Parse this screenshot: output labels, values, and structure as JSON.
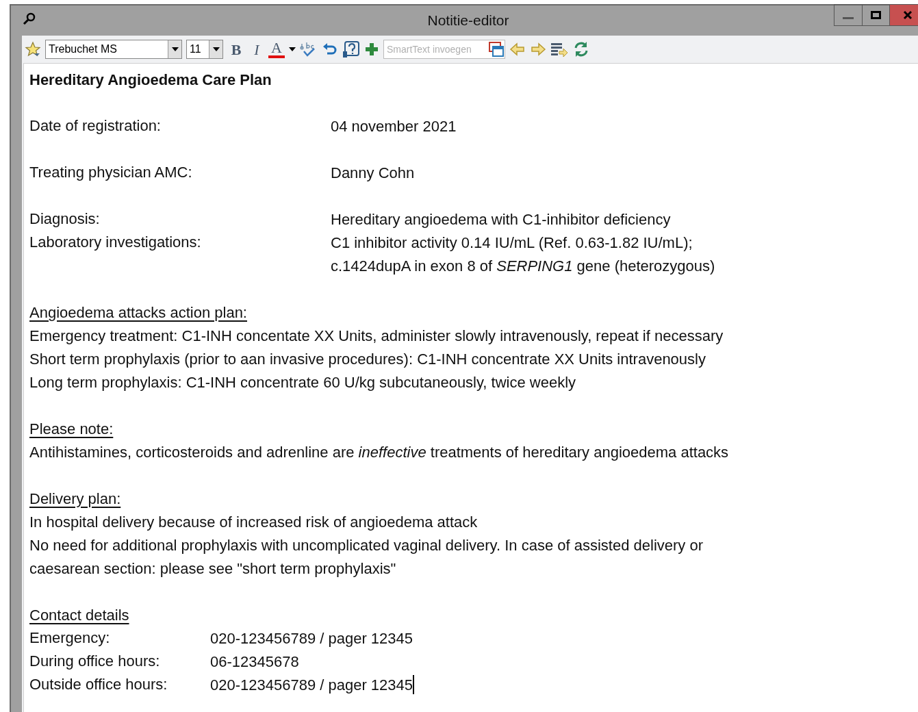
{
  "window": {
    "title": "Notitie-editor"
  },
  "toolbar": {
    "font": "Trebuchet MS",
    "size": "11",
    "bold": "B",
    "italic": "I",
    "color_letter": "A",
    "smarttext_placeholder": "SmartText invoegen"
  },
  "document": {
    "title": "Hereditary Angioedema Care Plan",
    "blocks": [
      {
        "kind": "fields",
        "fields": [
          {
            "label": "Date of registration:",
            "lines": [
              "04 november 2021"
            ]
          }
        ]
      },
      {
        "kind": "fields",
        "fields": [
          {
            "label": "Treating physician AMC:",
            "lines": [
              "Danny Cohn"
            ]
          }
        ]
      },
      {
        "kind": "fields",
        "fields": [
          {
            "label": "Diagnosis:",
            "lines": [
              "Hereditary angioedema with C1-inhibitor deficiency"
            ]
          },
          {
            "label": "Laboratory investigations:",
            "lines": [
              "C1 inhibitor activity 0.14 IU/mL (Ref. 0.63-1.82 IU/mL);",
              "c.1424dupA in exon 8 of *SERPING1* gene (heterozygous)"
            ]
          }
        ]
      },
      {
        "kind": "section",
        "heading": "Angioedema attacks action plan:",
        "lines": [
          "Emergency treatment: C1-INH concentate XX Units, administer slowly intravenously, repeat if necessary",
          "Short term prophylaxis (prior to aan invasive procedures): C1-INH concentrate XX Units intravenously",
          "Long term prophylaxis: C1-INH concentrate 60 U/kg subcutaneously, twice weekly"
        ]
      },
      {
        "kind": "section",
        "heading": "Please note:",
        "lines": [
          "Antihistamines, corticosteroids and adrenline are *ineffective* treatments of hereditary angioedema attacks"
        ]
      },
      {
        "kind": "section",
        "heading": "Delivery plan:",
        "lines": [
          "In hospital delivery because of increased risk of angioedema attack",
          "No need for additional prophylaxis with uncomplicated vaginal delivery. In case of assisted delivery or",
          "caesarean section: please see \"short term prophylaxis\""
        ]
      },
      {
        "kind": "contact",
        "heading": "Contact details",
        "fields": [
          {
            "label": "Emergency:",
            "lines": [
              "020-123456789 / pager 12345"
            ]
          },
          {
            "label": "During office hours:",
            "lines": [
              "06-12345678"
            ]
          },
          {
            "label": "Outside office hours:",
            "lines": [
              "020-123456789 / pager 12345"
            ]
          }
        ]
      }
    ]
  }
}
